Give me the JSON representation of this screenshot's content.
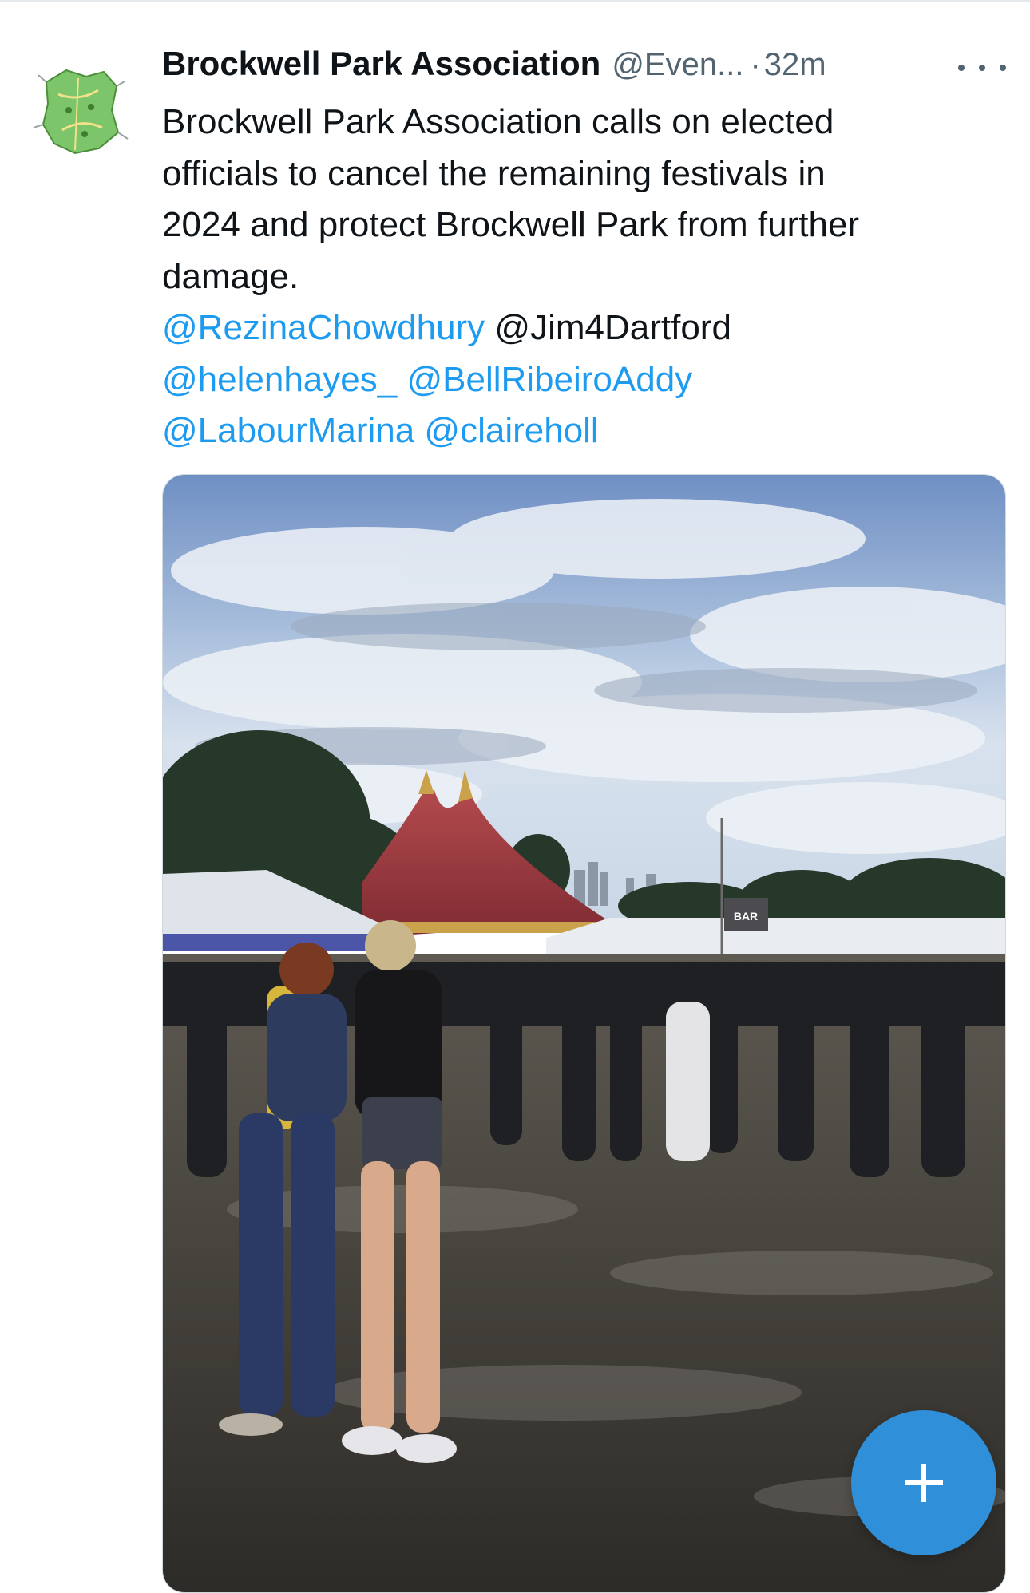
{
  "tweet": {
    "display_name": "Brockwell Park Association",
    "handle": "@Even...",
    "separator": "·",
    "time": "32m",
    "text_lines": [
      "Brockwell Park Association calls on elected",
      "officials to cancel the remaining festivals in",
      "2024 and protect Brockwell Park from further",
      "damage."
    ],
    "mentions": {
      "line1": [
        "@RezinaChowdhury",
        "@Jim4Dartford"
      ],
      "line2": [
        "@helenhayes_",
        "@BellRibeiroAddy"
      ],
      "line3": [
        "@LabourMarina",
        "@claireholl"
      ]
    },
    "media": {
      "bar_sign": "BAR"
    }
  },
  "icons": {
    "avatar": "park-map-icon",
    "more": "more-horizontal-icon",
    "compose": "plus-icon"
  },
  "colors": {
    "link": "#1d9bf0",
    "text": "#0f1419",
    "secondary": "#536471",
    "fab": "#2f8fd8"
  }
}
